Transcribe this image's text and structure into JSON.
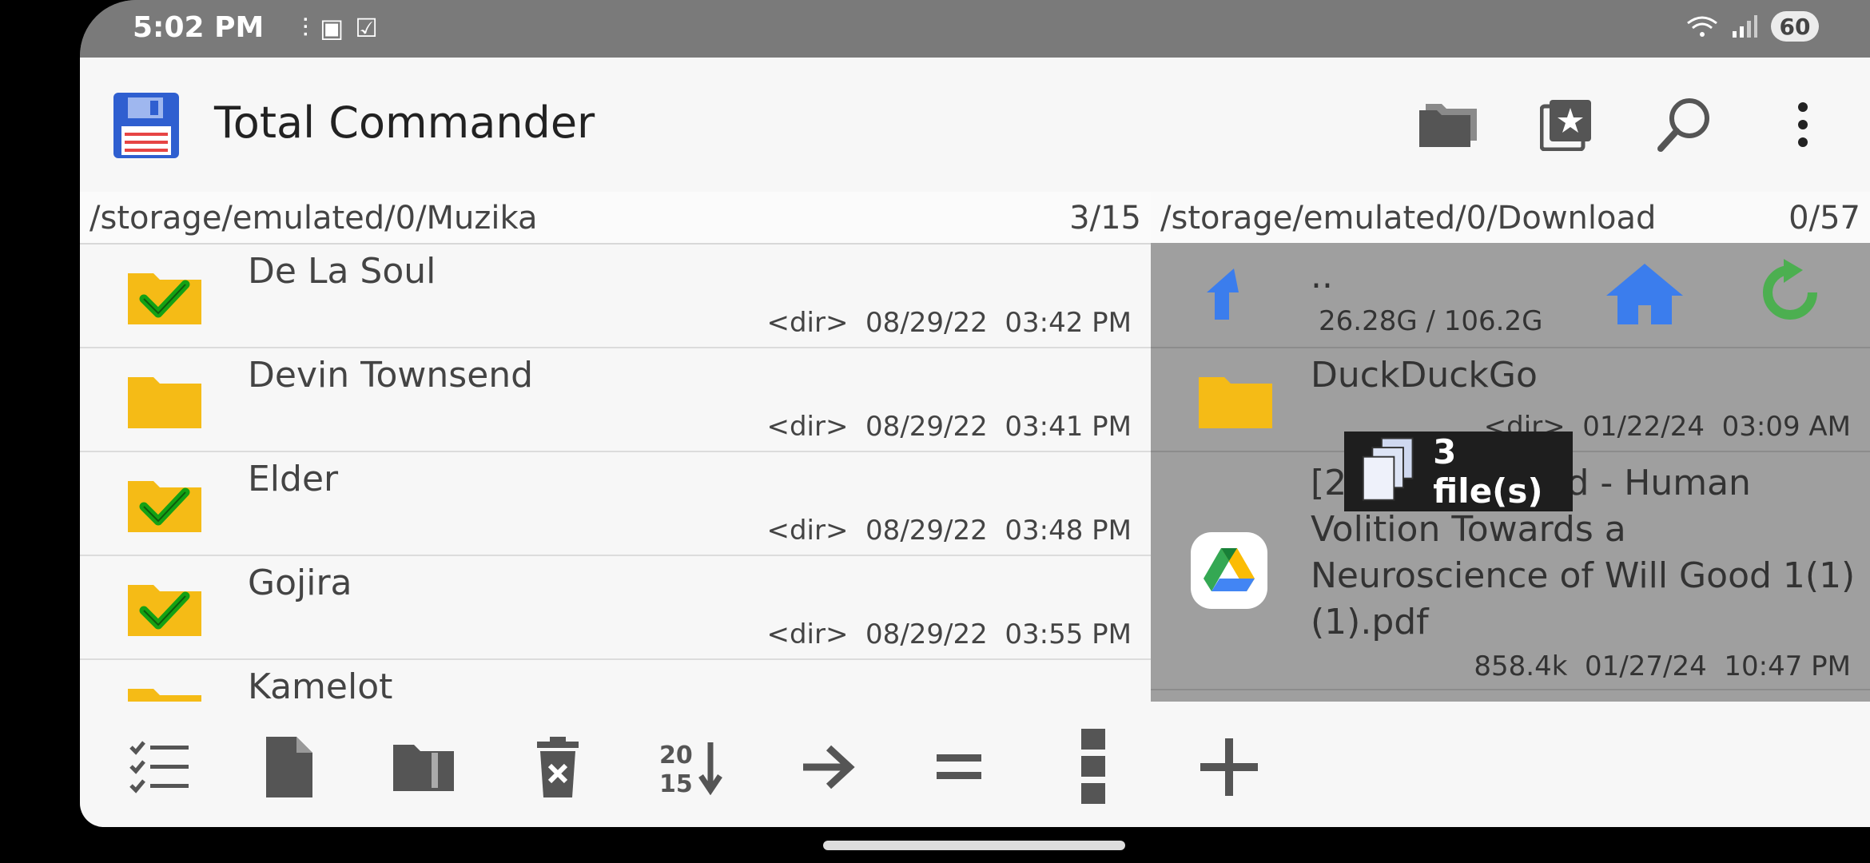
{
  "status": {
    "time": "5:02 PM",
    "battery": "60"
  },
  "app": {
    "title": "Total Commander"
  },
  "left_panel": {
    "path": "/storage/emulated/0/Muzika",
    "count": "3/15",
    "items": [
      {
        "name": "De La Soul",
        "meta": "<dir>  08/29/22  03:42 PM",
        "checked": true
      },
      {
        "name": "Devin Townsend",
        "meta": "<dir>  08/29/22  03:41 PM",
        "checked": false
      },
      {
        "name": "Elder",
        "meta": "<dir>  08/29/22  03:48 PM",
        "checked": true
      },
      {
        "name": "Gojira",
        "meta": "<dir>  08/29/22  03:55 PM",
        "checked": true
      },
      {
        "name": "Kamelot",
        "meta": "",
        "checked": false
      }
    ]
  },
  "right_panel": {
    "path": "/storage/emulated/0/Download",
    "count": "0/57",
    "up_label": "..",
    "free_space": "26.28G / 106.2G",
    "items": [
      {
        "name": "DuckDuckGo",
        "meta": "<dir>  01/22/24  03:09 AM"
      },
      {
        "name": "[2022] Haggard - Human Volition Towards a Neuroscience of Will Good 1(1)(1).pdf",
        "meta": "858.4k  01/27/24  10:47 PM"
      }
    ]
  },
  "drag_badge": {
    "label": "3 file(s)"
  },
  "colors": {
    "folder": "#f5bb16",
    "check": "#14a114",
    "blue": "#3b7ded",
    "green": "#4caf50"
  }
}
